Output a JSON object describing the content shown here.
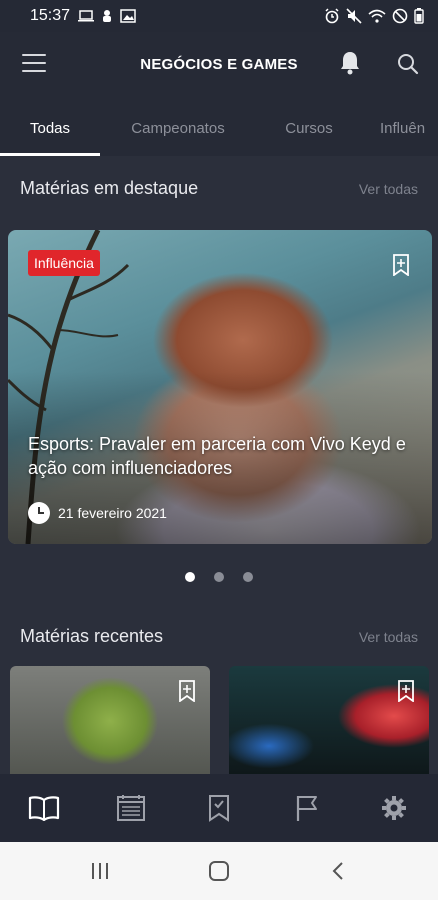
{
  "status_bar": {
    "time": "15:37",
    "left_icons": [
      "laptop-icon",
      "thumbs-icon",
      "gallery-icon"
    ],
    "right_icons": [
      "alarm-icon",
      "mute-icon",
      "wifi-icon",
      "dnd-icon",
      "battery-icon"
    ]
  },
  "header": {
    "title": "NEGÓCIOS E GAMES",
    "menu_icon": "hamburger-icon",
    "bell_icon": "bell-icon",
    "search_icon": "search-icon"
  },
  "tabs": [
    {
      "label": "Todas",
      "active": true
    },
    {
      "label": "Campeonatos",
      "active": false
    },
    {
      "label": "Cursos",
      "active": false
    },
    {
      "label": "Influên",
      "active": false
    }
  ],
  "featured": {
    "section_title": "Matérias em destaque",
    "see_all": "Ver todas",
    "badge": "Influência",
    "title": "Esports: Pravaler em parceria com Vivo Keyd e ação com influenciadores",
    "date": "21 fevereiro 2021",
    "carousel_count": 3,
    "carousel_active_index": 0
  },
  "recent": {
    "section_title": "Matérias recentes",
    "see_all": "Ver todas"
  },
  "bottom_nav": [
    {
      "icon": "open-book-icon",
      "active": true
    },
    {
      "icon": "newspaper-icon",
      "active": false
    },
    {
      "icon": "bookmark-list-icon",
      "active": false
    },
    {
      "icon": "flag-icon",
      "active": false
    },
    {
      "icon": "gear-icon",
      "active": false
    }
  ],
  "colors": {
    "background": "#262a36",
    "content": "#2b2f3b",
    "badge": "#e0262b",
    "muted_text": "#7e828d"
  }
}
